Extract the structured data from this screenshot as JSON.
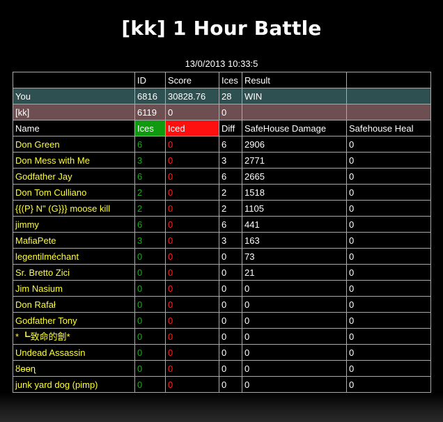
{
  "title": "[kk] 1 Hour Battle",
  "timestamp": "13/0/2013 10:33:5",
  "summary_headers": [
    "",
    "ID",
    "Score",
    "Ices",
    "Result",
    ""
  ],
  "you_row": [
    "You",
    "6816",
    "30828.76",
    "28",
    "WIN",
    ""
  ],
  "clan_row": [
    "[kk]",
    "6119",
    "0",
    "0",
    "",
    ""
  ],
  "player_headers": [
    "Name",
    "Ices",
    "Iced",
    "Diff",
    "SafeHouse Damage",
    "Safehouse Heal"
  ],
  "colors": {
    "you_row": "#2f5050",
    "clan_row": "#6d4f52",
    "name": "#ffff33",
    "ices": "#1faa1f",
    "iced": "#ff2020"
  },
  "players": [
    {
      "name": "Don Green",
      "ices": "6",
      "iced": "0",
      "diff": "6",
      "damage": "2906",
      "heal": "0"
    },
    {
      "name": "Don Mess with Me",
      "ices": "3",
      "iced": "0",
      "diff": "3",
      "damage": "2771",
      "heal": "0"
    },
    {
      "name": "Godfather Jay",
      "ices": "6",
      "iced": "0",
      "diff": "6",
      "damage": "2665",
      "heal": "0"
    },
    {
      "name": "Don Tom Culliano",
      "ices": "2",
      "iced": "0",
      "diff": "2",
      "damage": "1518",
      "heal": "0"
    },
    {
      "name": "{{(P} N\" (G}}} moose kill",
      "ices": "2",
      "iced": "0",
      "diff": "2",
      "damage": "1105",
      "heal": "0"
    },
    {
      "name": "jimmy",
      "ices": "6",
      "iced": "0",
      "diff": "6",
      "damage": "441",
      "heal": "0"
    },
    {
      "name": "MafiaPete",
      "ices": "3",
      "iced": "0",
      "diff": "3",
      "damage": "163",
      "heal": "0"
    },
    {
      "name": "legentilméchant",
      "ices": "0",
      "iced": "0",
      "diff": "0",
      "damage": "73",
      "heal": "0"
    },
    {
      "name": "Sr. Bretto Zici",
      "ices": "0",
      "iced": "0",
      "diff": "0",
      "damage": "21",
      "heal": "0"
    },
    {
      "name": "Jim Nasium",
      "ices": "0",
      "iced": "0",
      "diff": "0",
      "damage": "0",
      "heal": "0"
    },
    {
      "name": "Don Rafał",
      "ices": "0",
      "iced": "0",
      "diff": "0",
      "damage": "0",
      "heal": "0"
    },
    {
      "name": "Godfather Tony",
      "ices": "0",
      "iced": "0",
      "diff": "0",
      "damage": "0",
      "heal": "0"
    },
    {
      "name": "* ┗致命的劊*",
      "ices": "0",
      "iced": "0",
      "diff": "0",
      "damage": "0",
      "heal": "0"
    },
    {
      "name": "Undead Assassin",
      "ices": "0",
      "iced": "0",
      "diff": "0",
      "damage": "0",
      "heal": "0"
    },
    {
      "name": "ȣɵɵɳ",
      "ices": "0",
      "iced": "0",
      "diff": "0",
      "damage": "0",
      "heal": "0"
    },
    {
      "name": "junk yard dog (pimp)",
      "ices": "0",
      "iced": "0",
      "diff": "0",
      "damage": "0",
      "heal": "0"
    }
  ]
}
